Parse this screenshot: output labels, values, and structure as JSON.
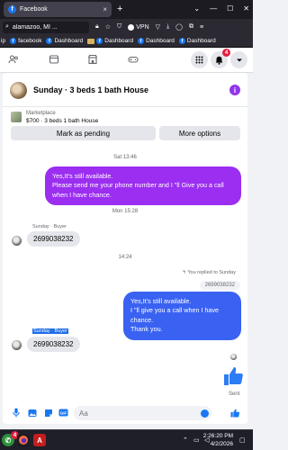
{
  "browser": {
    "tab_title": "Facebook",
    "tab_close": "×",
    "new_tab": "+",
    "address": "alamazoo, MI ...",
    "vpn_label": "VPN"
  },
  "bookmarks": [
    {
      "label": "ip"
    },
    {
      "label": "facebook"
    },
    {
      "label": "Dashboard"
    },
    {
      "label": "Dashboard"
    },
    {
      "label": "Dashboard"
    },
    {
      "label": "Dashboard"
    }
  ],
  "nav": {
    "notification_count": "4"
  },
  "conversation": {
    "title": "Sunday · 3 beds 1 bath House",
    "info_glyph": "i",
    "marketplace_label": "Marketplace",
    "listing": "$700 · 3 beds 1 bath House",
    "mark_pending": "Mark as pending",
    "more_options": "More options"
  },
  "messages": {
    "ts1": "Sat 13:46",
    "out1": "Yes,It's still available.\nPlease send me your phone number and I \"ll Give you a call when I have chance.",
    "ts2": "Mon 15:28",
    "sender1": "Sunday · Buyer",
    "in1": "2699038232",
    "ts3": "14:24",
    "replied": "You replied to Sunday",
    "quoted": "2699038232",
    "out2": "Yes,It's still available.\nI \"ll give you a call when I have chance.\nThank you.",
    "sender2": "Sunday · Buyer",
    "in2": "2699038232",
    "sent": "Sent"
  },
  "composer": {
    "placeholder": "Aa"
  },
  "taskbar": {
    "time": "2:26:20 PM",
    "date": "4/2/2026",
    "adobe_label": "A"
  },
  "colors": {
    "accent": "#1877f2",
    "bubble_purple": "#9b2ef0",
    "bubble_blue": "#3a62f2",
    "badge": "#e41e3f"
  }
}
